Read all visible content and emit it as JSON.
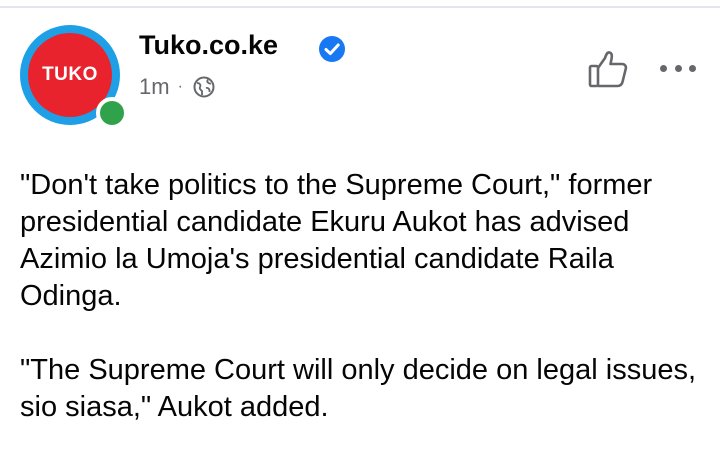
{
  "post": {
    "avatar_text": "TUKO",
    "page_name": "Tuko.co.ke",
    "time": "1m",
    "separator": "·",
    "paragraphs": [
      "\"Don't take politics to the Supreme Court,\" former presidential candidate Ekuru Aukot has advised Azimio la Umoja's presidential candidate Raila Odinga.",
      "\"The Supreme Court will only decide on legal issues, sio siasa,\" Aukot added."
    ]
  },
  "icons": {
    "verified": "verified-badge-icon",
    "audience": "globe-icon",
    "like": "thumbs-up-icon",
    "more": "more-options-icon"
  },
  "colors": {
    "brand_red": "#e8232d",
    "avatar_ring": "#1fa0e6",
    "online": "#31a24c",
    "verified_blue": "#1877f2",
    "secondary_text": "#65676b"
  }
}
